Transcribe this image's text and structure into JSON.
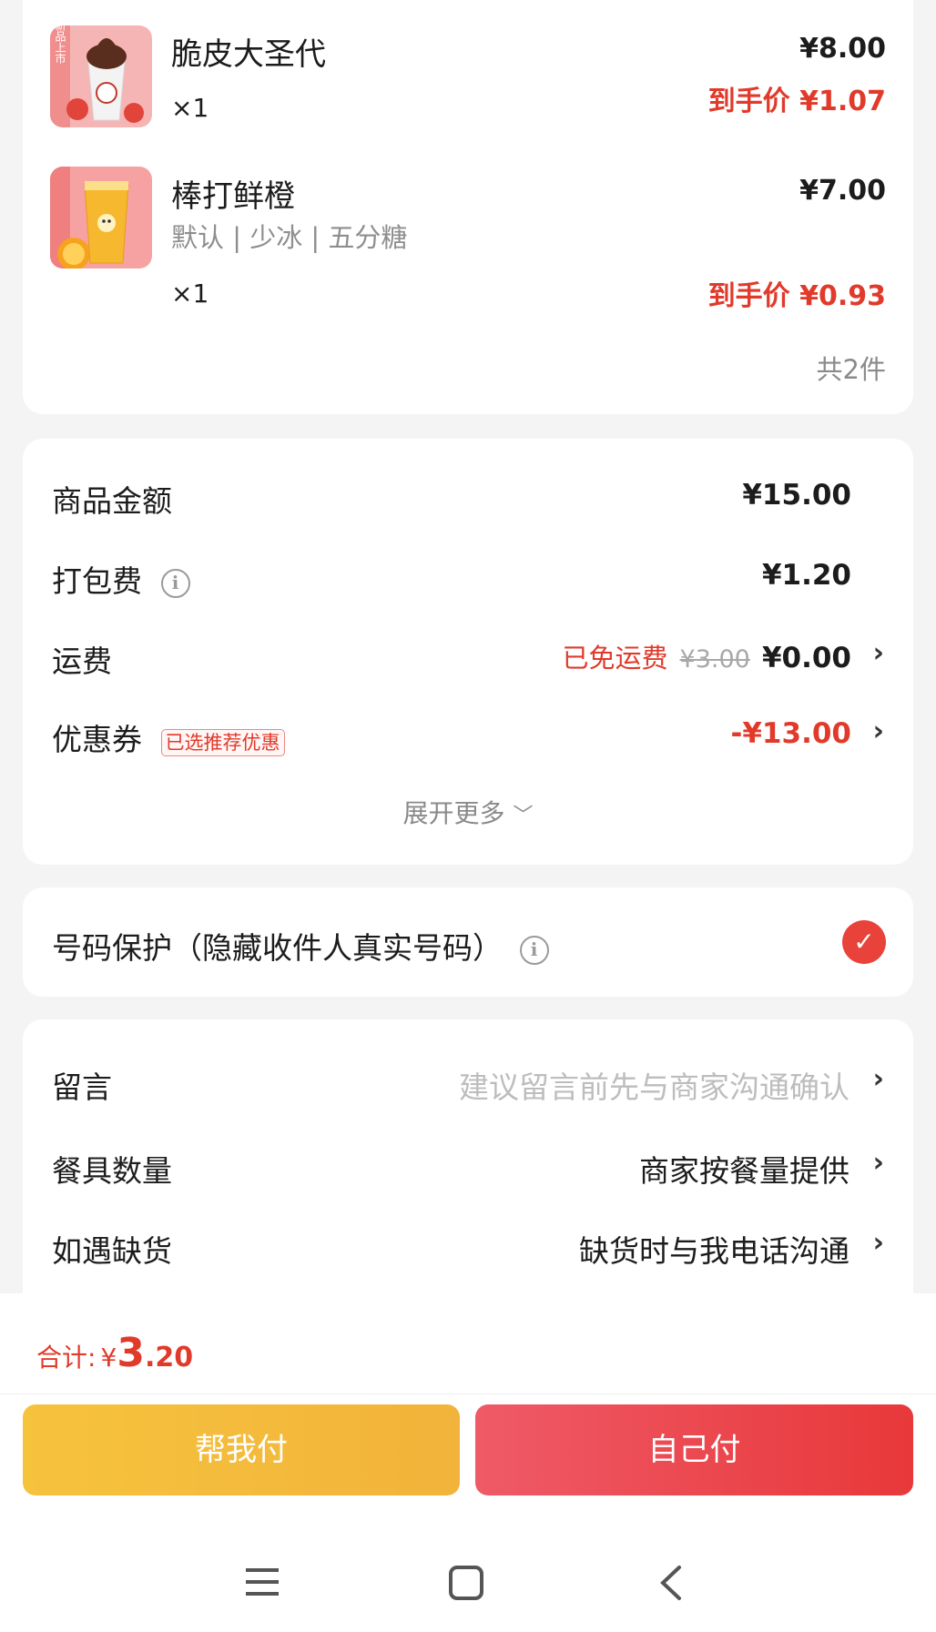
{
  "products": [
    {
      "name": "脆皮大圣代",
      "options": "",
      "qty": "×1",
      "price": "¥8.00",
      "deal_label": "到手价",
      "deal_price": "¥1.07",
      "thumb_text": "新品上市"
    },
    {
      "name": "棒打鲜橙",
      "options": "默认 | 少冰 | 五分糖",
      "qty": "×1",
      "price": "¥7.00",
      "deal_label": "到手价",
      "deal_price": "¥0.93",
      "thumb_text": "经典刷击"
    }
  ],
  "item_count": "共2件",
  "fees": {
    "goods_label": "商品金额",
    "goods_value": "¥15.00",
    "pack_label": "打包费",
    "pack_value": "¥1.20",
    "ship_label": "运费",
    "ship_free": "已免运费",
    "ship_original": "¥3.00",
    "ship_value": "¥0.00",
    "coupon_label": "优惠券",
    "coupon_tag": "已选推荐优惠",
    "coupon_value": "-¥13.00",
    "expand": "展开更多"
  },
  "privacy": {
    "label": "号码保护（隐藏收件人真实号码）",
    "checked": true
  },
  "options": {
    "note_label": "留言",
    "note_hint": "建议留言前先与商家沟通确认",
    "tableware_label": "餐具数量",
    "tableware_value": "商家按餐量提供",
    "stockout_label": "如遇缺货",
    "stockout_value": "缺货时与我电话沟通"
  },
  "footer": {
    "total_label": "合计:",
    "currency": "¥",
    "total_int": "3",
    "total_dec": ".20",
    "help_pay": "帮我付",
    "self_pay": "自己付"
  },
  "colors": {
    "accent_red": "#e13a2b",
    "help_pay_bg": "#f6c33d",
    "self_pay_bg": "#e8383a"
  },
  "icons": {
    "info": "info-icon",
    "check": "check-icon",
    "chevron": "chevron-right-icon",
    "expand": "chevron-down-icon",
    "nav_menu": "menu-icon",
    "nav_home": "home-square-icon",
    "nav_back": "back-icon"
  }
}
